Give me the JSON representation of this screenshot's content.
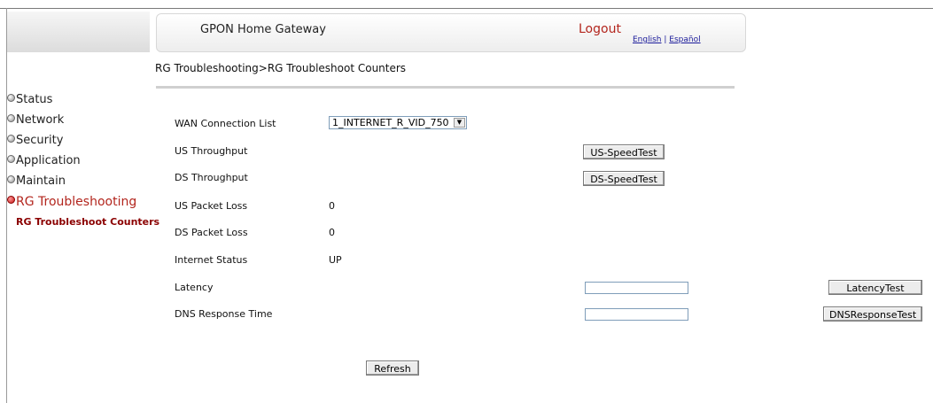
{
  "header": {
    "title": "GPON Home Gateway",
    "logout": "Logout",
    "lang_english": "English",
    "lang_sep": " | ",
    "lang_spanish": "Español"
  },
  "breadcrumb": "RG Troubleshooting>RG Troubleshoot Counters",
  "nav": {
    "items": [
      {
        "label": "Status",
        "icon": "expand-icon"
      },
      {
        "label": "Network",
        "icon": "expand-icon"
      },
      {
        "label": "Security",
        "icon": "expand-icon"
      },
      {
        "label": "Application",
        "icon": "expand-icon"
      },
      {
        "label": "Maintain",
        "icon": "expand-icon"
      },
      {
        "label": "RG Troubleshooting",
        "icon": "collapse-icon"
      }
    ],
    "active_sub": "RG Troubleshoot Counters"
  },
  "form": {
    "wan_label": "WAN Connection List",
    "wan_selected": "1_INTERNET_R_VID_750",
    "us_throughput_label": "US Throughput",
    "us_speedtest": "US-SpeedTest",
    "ds_throughput_label": "DS Throughput",
    "ds_speedtest": "DS-SpeedTest",
    "us_loss_label": "US Packet Loss",
    "us_loss_value": "0",
    "ds_loss_label": "DS Packet Loss",
    "ds_loss_value": "0",
    "internet_status_label": "Internet Status",
    "internet_status_value": "UP",
    "latency_label": "Latency",
    "latency_value": "",
    "latency_button": "LatencyTest",
    "dns_label": "DNS Response Time",
    "dns_value": "",
    "dns_button": "DNSResponseTest",
    "refresh": "Refresh"
  },
  "colors": {
    "accent_red": "#b3261e",
    "sub_nav": "#8b0000",
    "link_blue": "#1a1a9a"
  }
}
